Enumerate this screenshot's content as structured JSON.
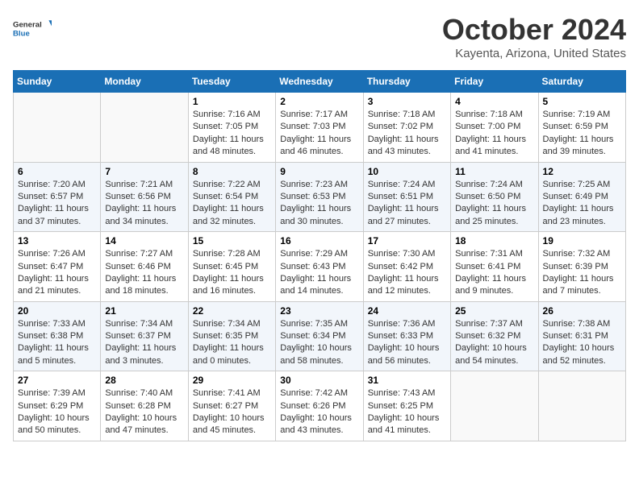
{
  "logo": {
    "line1": "General",
    "line2": "Blue"
  },
  "title": "October 2024",
  "location": "Kayenta, Arizona, United States",
  "days_of_week": [
    "Sunday",
    "Monday",
    "Tuesday",
    "Wednesday",
    "Thursday",
    "Friday",
    "Saturday"
  ],
  "weeks": [
    [
      {
        "day": "",
        "info": ""
      },
      {
        "day": "",
        "info": ""
      },
      {
        "day": "1",
        "info": "Sunrise: 7:16 AM\nSunset: 7:05 PM\nDaylight: 11 hours and 48 minutes."
      },
      {
        "day": "2",
        "info": "Sunrise: 7:17 AM\nSunset: 7:03 PM\nDaylight: 11 hours and 46 minutes."
      },
      {
        "day": "3",
        "info": "Sunrise: 7:18 AM\nSunset: 7:02 PM\nDaylight: 11 hours and 43 minutes."
      },
      {
        "day": "4",
        "info": "Sunrise: 7:18 AM\nSunset: 7:00 PM\nDaylight: 11 hours and 41 minutes."
      },
      {
        "day": "5",
        "info": "Sunrise: 7:19 AM\nSunset: 6:59 PM\nDaylight: 11 hours and 39 minutes."
      }
    ],
    [
      {
        "day": "6",
        "info": "Sunrise: 7:20 AM\nSunset: 6:57 PM\nDaylight: 11 hours and 37 minutes."
      },
      {
        "day": "7",
        "info": "Sunrise: 7:21 AM\nSunset: 6:56 PM\nDaylight: 11 hours and 34 minutes."
      },
      {
        "day": "8",
        "info": "Sunrise: 7:22 AM\nSunset: 6:54 PM\nDaylight: 11 hours and 32 minutes."
      },
      {
        "day": "9",
        "info": "Sunrise: 7:23 AM\nSunset: 6:53 PM\nDaylight: 11 hours and 30 minutes."
      },
      {
        "day": "10",
        "info": "Sunrise: 7:24 AM\nSunset: 6:51 PM\nDaylight: 11 hours and 27 minutes."
      },
      {
        "day": "11",
        "info": "Sunrise: 7:24 AM\nSunset: 6:50 PM\nDaylight: 11 hours and 25 minutes."
      },
      {
        "day": "12",
        "info": "Sunrise: 7:25 AM\nSunset: 6:49 PM\nDaylight: 11 hours and 23 minutes."
      }
    ],
    [
      {
        "day": "13",
        "info": "Sunrise: 7:26 AM\nSunset: 6:47 PM\nDaylight: 11 hours and 21 minutes."
      },
      {
        "day": "14",
        "info": "Sunrise: 7:27 AM\nSunset: 6:46 PM\nDaylight: 11 hours and 18 minutes."
      },
      {
        "day": "15",
        "info": "Sunrise: 7:28 AM\nSunset: 6:45 PM\nDaylight: 11 hours and 16 minutes."
      },
      {
        "day": "16",
        "info": "Sunrise: 7:29 AM\nSunset: 6:43 PM\nDaylight: 11 hours and 14 minutes."
      },
      {
        "day": "17",
        "info": "Sunrise: 7:30 AM\nSunset: 6:42 PM\nDaylight: 11 hours and 12 minutes."
      },
      {
        "day": "18",
        "info": "Sunrise: 7:31 AM\nSunset: 6:41 PM\nDaylight: 11 hours and 9 minutes."
      },
      {
        "day": "19",
        "info": "Sunrise: 7:32 AM\nSunset: 6:39 PM\nDaylight: 11 hours and 7 minutes."
      }
    ],
    [
      {
        "day": "20",
        "info": "Sunrise: 7:33 AM\nSunset: 6:38 PM\nDaylight: 11 hours and 5 minutes."
      },
      {
        "day": "21",
        "info": "Sunrise: 7:34 AM\nSunset: 6:37 PM\nDaylight: 11 hours and 3 minutes."
      },
      {
        "day": "22",
        "info": "Sunrise: 7:34 AM\nSunset: 6:35 PM\nDaylight: 11 hours and 0 minutes."
      },
      {
        "day": "23",
        "info": "Sunrise: 7:35 AM\nSunset: 6:34 PM\nDaylight: 10 hours and 58 minutes."
      },
      {
        "day": "24",
        "info": "Sunrise: 7:36 AM\nSunset: 6:33 PM\nDaylight: 10 hours and 56 minutes."
      },
      {
        "day": "25",
        "info": "Sunrise: 7:37 AM\nSunset: 6:32 PM\nDaylight: 10 hours and 54 minutes."
      },
      {
        "day": "26",
        "info": "Sunrise: 7:38 AM\nSunset: 6:31 PM\nDaylight: 10 hours and 52 minutes."
      }
    ],
    [
      {
        "day": "27",
        "info": "Sunrise: 7:39 AM\nSunset: 6:29 PM\nDaylight: 10 hours and 50 minutes."
      },
      {
        "day": "28",
        "info": "Sunrise: 7:40 AM\nSunset: 6:28 PM\nDaylight: 10 hours and 47 minutes."
      },
      {
        "day": "29",
        "info": "Sunrise: 7:41 AM\nSunset: 6:27 PM\nDaylight: 10 hours and 45 minutes."
      },
      {
        "day": "30",
        "info": "Sunrise: 7:42 AM\nSunset: 6:26 PM\nDaylight: 10 hours and 43 minutes."
      },
      {
        "day": "31",
        "info": "Sunrise: 7:43 AM\nSunset: 6:25 PM\nDaylight: 10 hours and 41 minutes."
      },
      {
        "day": "",
        "info": ""
      },
      {
        "day": "",
        "info": ""
      }
    ]
  ],
  "accent_color": "#1a6fb5"
}
